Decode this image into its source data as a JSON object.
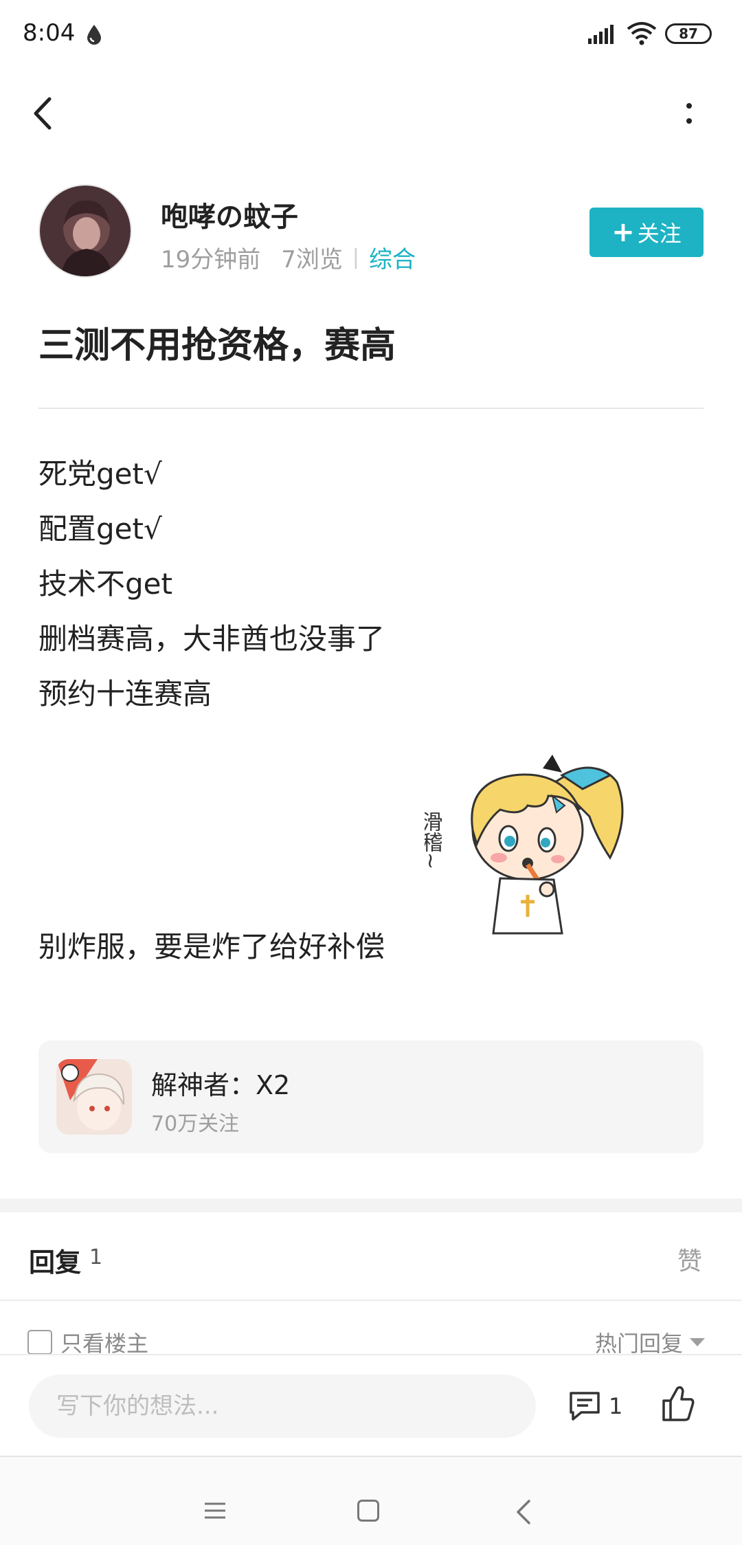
{
  "status_bar": {
    "time": "8:04",
    "battery": "87"
  },
  "post": {
    "author": "咆哮の蚊子",
    "time_ago": "19分钟前",
    "views": "7浏览",
    "category": "综合",
    "follow_label": "关注",
    "title": "三测不用抢资格，赛高",
    "lines": [
      "死党get√",
      "配置get√",
      "技术不get",
      "删档赛高，大非酋也没事了",
      "预约十连赛高"
    ],
    "last_line": "别炸服，要是炸了给好补偿",
    "sticker_text": "滑稽~"
  },
  "game_card": {
    "name": "解神者：X2",
    "followers": "70万关注"
  },
  "replies": {
    "title": "回复",
    "count": "1",
    "like_tab": "赞",
    "only_op": "只看楼主",
    "sort": "热门回复"
  },
  "input_bar": {
    "placeholder": "写下你的想法...",
    "comment_count": "1"
  },
  "colors": {
    "accent": "#1db3c4"
  }
}
